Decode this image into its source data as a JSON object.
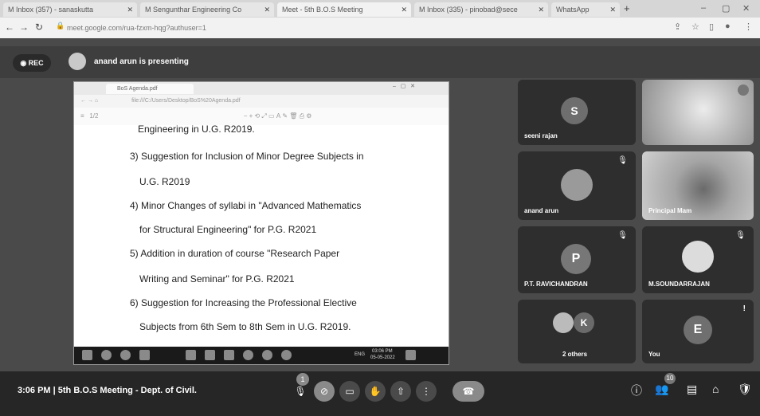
{
  "browser": {
    "tabs": [
      {
        "title": "M Inbox (357) - sanaskutta"
      },
      {
        "title": "M Sengunthar Engineering Co"
      },
      {
        "title": "Meet - 5th B.O.S Meeting"
      },
      {
        "title": "M Inbox (335) - pinobad@sece"
      },
      {
        "title": "WhatsApp"
      }
    ],
    "url": "meet.google.com/rua-fzxm-hqg?authuser=1"
  },
  "meeting": {
    "rec_label": "REC",
    "presenter_text": "anand arun is presenting",
    "time": "3:06 PM",
    "separator": "|",
    "title": "5th B.O.S Meeting - Dept. of Civil.",
    "hand_count": "1",
    "people_count": "10"
  },
  "shared_screen": {
    "tab_title": "BoS Agenda.pdf",
    "url": "file:///C:/Users/Desktop/BoS%20Agenda.pdf",
    "lines": [
      "Engineering  in U.G. R2019.",
      "3) Suggestion for Inclusion of Minor Degree Subjects in",
      "U.G. R2019",
      "4) Minor Changes of syllabi in \"Advanced Mathematics",
      "for Structural Engineering\" for P.G. R2021",
      "5) Addition  in  duration  of  course  \"Research  Paper",
      "Writing and Seminar\" for P.G. R2021",
      "6) Suggestion  for  Increasing  the  Professional  Elective",
      "Subjects from 6th Sem to 8th Sem in U.G. R2019."
    ],
    "taskbar_time": "03:06 PM",
    "taskbar_date": "05-05-2022",
    "taskbar_lang": "ENG"
  },
  "participants": [
    {
      "name": "seeni rajan",
      "initial": "S",
      "color": "#6e6e6e"
    },
    {
      "name": "",
      "initial": "",
      "color": "#bdbdbd"
    },
    {
      "name": "anand arun",
      "initial": "",
      "color": "#9a9a9a"
    },
    {
      "name": "Principal Mam",
      "initial": "",
      "color": "#8c8c8c"
    },
    {
      "name": "P.T. RAVICHANDRAN",
      "initial": "P",
      "color": "#777777"
    },
    {
      "name": "M.SOUNDARRAJAN",
      "initial": "",
      "color": "#dcdcdc"
    },
    {
      "name": "2 others",
      "initial": "K",
      "color": "#6a6a6a"
    },
    {
      "name": "You",
      "initial": "E",
      "color": "#6f6f6f"
    }
  ],
  "icons": [
    "record-icon",
    "presenter-avatar",
    "mic-off-icon",
    "camera-off-icon",
    "captions-icon",
    "raise-hand-icon",
    "present-icon",
    "more-options-icon",
    "end-call-icon",
    "info-icon",
    "people-icon",
    "chat-icon",
    "activities-icon",
    "host-controls-icon"
  ]
}
